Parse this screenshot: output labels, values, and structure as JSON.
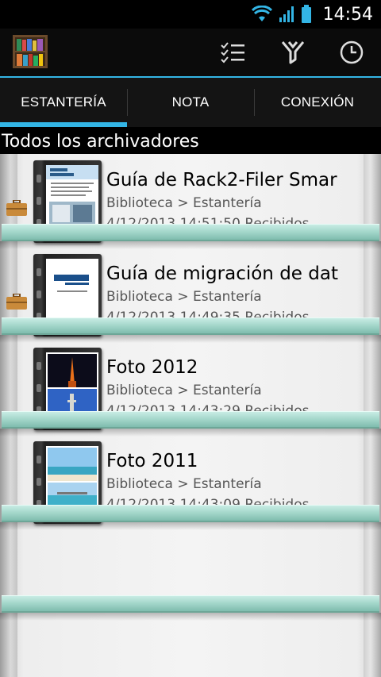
{
  "status_bar": {
    "time": "14:54",
    "icons": [
      "wifi-icon",
      "signal-icon",
      "battery-icon"
    ]
  },
  "action_bar": {
    "logo": "rack2-filer-bookshelf-logo",
    "actions": [
      "checklist-icon",
      "filter-icon",
      "clock-icon"
    ]
  },
  "tabs": [
    {
      "label": "ESTANTERÍA",
      "selected": true
    },
    {
      "label": "NOTA",
      "selected": false
    },
    {
      "label": "CONEXIÓN",
      "selected": false
    }
  ],
  "section_title": "Todos los archivadores",
  "items": [
    {
      "title": "Guía de Rack2-Filer Smar",
      "path": "Biblioteca > Estantería",
      "date": "4/12/2013 14:51:50 Recibidos",
      "icons": [
        "briefcase-icon",
        "computer-icon"
      ]
    },
    {
      "title": "Guía de migración de dat",
      "path": "Biblioteca > Estantería",
      "date": "4/12/2013 14:49:35 Recibidos",
      "icons": [
        "briefcase-icon",
        "computer-icon"
      ]
    },
    {
      "title": "Foto 2012",
      "path": "Biblioteca > Estantería",
      "date": "4/12/2013 14:43:29 Recibidos",
      "icons": [
        "computer-icon"
      ]
    },
    {
      "title": "Foto 2011",
      "path": "Biblioteca > Estantería",
      "date": "4/12/2013 14:43:09 Recibidos",
      "icons": [
        "computer-icon"
      ]
    }
  ],
  "colors": {
    "accent": "#33b5e5",
    "shelf_glass": "#a6d8cc"
  }
}
